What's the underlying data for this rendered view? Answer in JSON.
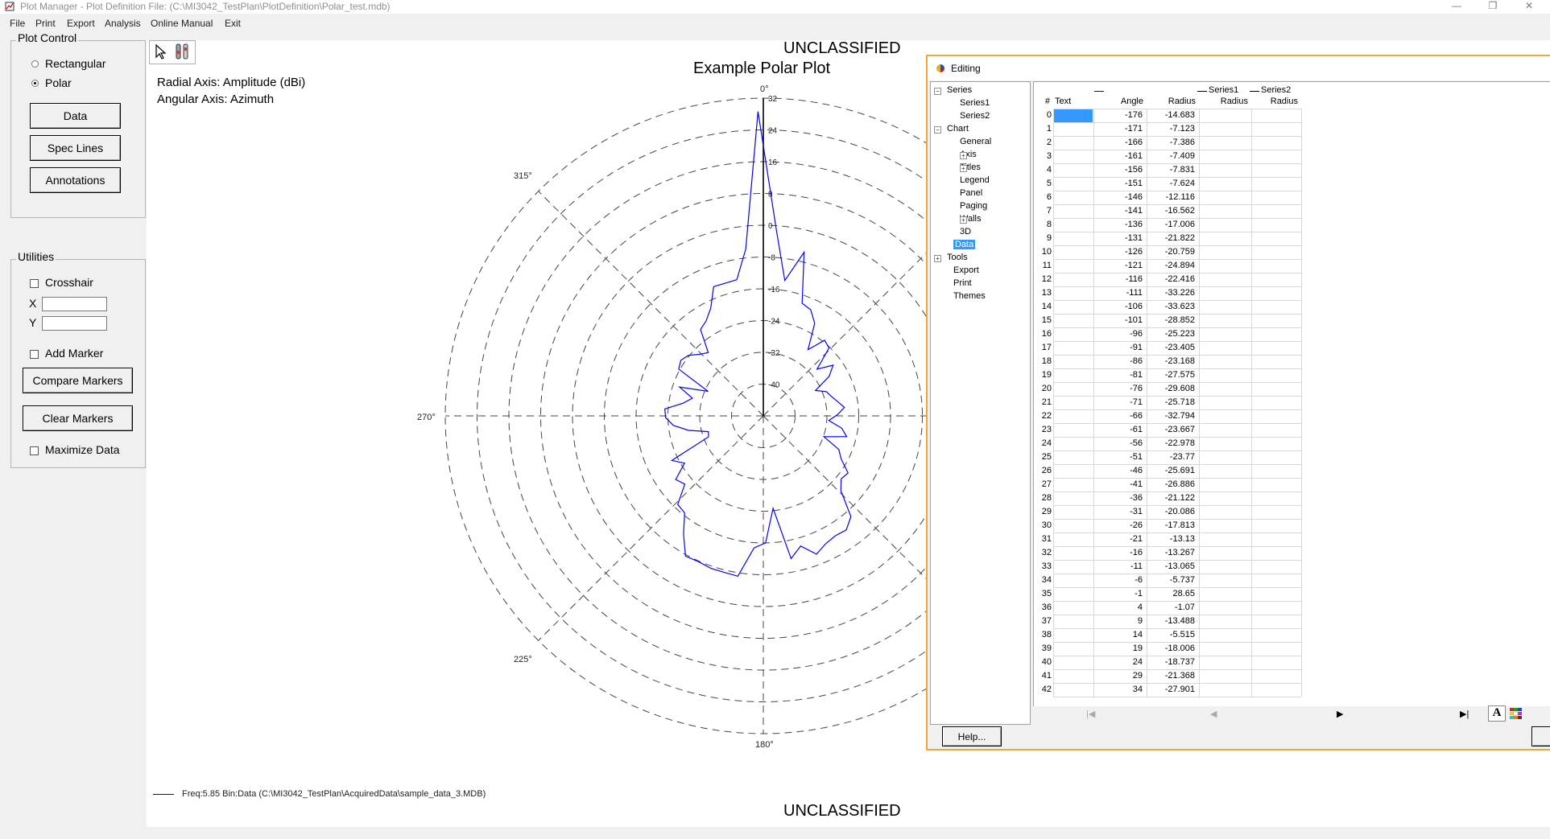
{
  "window": {
    "title": "Plot Manager - Plot Definition File: (C:\\MI3042_TestPlan\\PlotDefinition\\Polar_test.mdb)",
    "minimize_glyph": "—",
    "restore_glyph": "❐",
    "close_glyph": "✕"
  },
  "menu": [
    "File",
    "Print",
    "Export",
    "Analysis",
    "Online Manual",
    "Exit"
  ],
  "plot_control": {
    "title": "Plot Control",
    "options": [
      {
        "label": "Rectangular",
        "selected": false
      },
      {
        "label": "Polar",
        "selected": true
      }
    ],
    "buttons": {
      "data": "Data",
      "spec_lines": "Spec Lines",
      "annotations": "Annotations"
    }
  },
  "utilities": {
    "title": "Utilities",
    "crosshair_label": "Crosshair",
    "crosshair_checked": false,
    "x_label": "X",
    "y_label": "Y",
    "x_value": "",
    "y_value": "",
    "add_marker_label": "Add Marker",
    "add_marker_checked": false,
    "compare_markers": "Compare Markers",
    "clear_markers": "Clear Markers",
    "maximize_data_label": "Maximize Data",
    "maximize_data_checked": false
  },
  "plot": {
    "classification_top": "UNCLASSIFIED",
    "classification_bottom": "UNCLASSIFIED",
    "radial_axis_info": "Radial Axis: Amplitude (dBi)",
    "angular_axis_info": "Angular Axis: Azimuth",
    "legend_text": "Freq:5.85  Bin:Data  (C:\\MI3042_TestPlan\\AcquiredData\\sample_data_3.MDB)",
    "toolbar_icons": [
      "pointer-icon",
      "tools-icon"
    ],
    "series_color": "#0000ff"
  },
  "chart_data": {
    "type": "line",
    "projection": "polar",
    "title": "Example Polar Plot",
    "angle_labels": [
      "0°",
      "315°",
      "270°",
      "225°",
      "180°"
    ],
    "radial_ticks": [
      32,
      24,
      16,
      8,
      0,
      -8,
      -16,
      -24,
      -32,
      -40
    ],
    "radial_range": [
      -48,
      32
    ],
    "grid": true,
    "series": [
      {
        "name": "",
        "points": [
          [
            -176,
            -14.683
          ],
          [
            -171,
            -7.123
          ],
          [
            -166,
            -7.386
          ],
          [
            -161,
            -7.409
          ],
          [
            -156,
            -7.831
          ],
          [
            -151,
            -7.624
          ],
          [
            -146,
            -12.116
          ],
          [
            -141,
            -16.562
          ],
          [
            -136,
            -17.006
          ],
          [
            -131,
            -21.822
          ],
          [
            -126,
            -20.759
          ],
          [
            -121,
            -24.894
          ],
          [
            -116,
            -22.416
          ],
          [
            -111,
            -33.226
          ],
          [
            -106,
            -33.623
          ],
          [
            -101,
            -28.852
          ],
          [
            -96,
            -25.223
          ],
          [
            -91,
            -23.405
          ],
          [
            -86,
            -23.168
          ],
          [
            -81,
            -27.575
          ],
          [
            -76,
            -29.608
          ],
          [
            -71,
            -25.718
          ],
          [
            -66,
            -32.794
          ],
          [
            -61,
            -23.667
          ],
          [
            -56,
            -22.978
          ],
          [
            -51,
            -23.77
          ],
          [
            -46,
            -25.691
          ],
          [
            -41,
            -26.886
          ],
          [
            -36,
            -21.122
          ],
          [
            -31,
            -20.086
          ],
          [
            -26,
            -17.813
          ],
          [
            -21,
            -13.13
          ],
          [
            -16,
            -13.267
          ],
          [
            -11,
            -13.065
          ],
          [
            -6,
            -5.737
          ],
          [
            -1,
            28.65
          ],
          [
            4,
            -1.07
          ],
          [
            9,
            -13.488
          ],
          [
            14,
            -5.515
          ],
          [
            19,
            -18.006
          ],
          [
            24,
            -18.737
          ],
          [
            29,
            -21.368
          ],
          [
            34,
            -27.901
          ],
          [
            39,
            -23.5
          ],
          [
            44,
            -24.2
          ],
          [
            49,
            -30.1
          ],
          [
            54,
            -26.3
          ],
          [
            59,
            -28.7
          ],
          [
            64,
            -33.4
          ],
          [
            69,
            -31.0
          ],
          [
            74,
            -30.2
          ],
          [
            79,
            -29.0
          ],
          [
            84,
            -27.5
          ],
          [
            89,
            -29.3
          ],
          [
            94,
            -31.5
          ],
          [
            99,
            -28.0
          ],
          [
            104,
            -26.4
          ],
          [
            109,
            -31.9
          ],
          [
            114,
            -27.2
          ],
          [
            119,
            -25.6
          ],
          [
            124,
            -22.3
          ],
          [
            129,
            -22.8
          ],
          [
            134,
            -20.9
          ],
          [
            139,
            -14.4
          ],
          [
            144,
            -12.5
          ],
          [
            149,
            -12.8
          ],
          [
            154,
            -12.2
          ],
          [
            159,
            -10.7
          ],
          [
            164,
            -13.9
          ],
          [
            169,
            -11.4
          ],
          [
            174,
            -24.6
          ],
          [
            179,
            -16.0
          ]
        ]
      }
    ]
  },
  "editing": {
    "title": "Editing",
    "tree": [
      {
        "label": "Series",
        "indent": 0,
        "expander": "−"
      },
      {
        "label": "Series1",
        "indent": 2,
        "expander": ""
      },
      {
        "label": "Series2",
        "indent": 2,
        "expander": ""
      },
      {
        "label": "Chart",
        "indent": 0,
        "expander": "−"
      },
      {
        "label": "General",
        "indent": 2,
        "expander": ""
      },
      {
        "label": "Axis",
        "indent": 2,
        "expander": "+"
      },
      {
        "label": "Titles",
        "indent": 2,
        "expander": "+"
      },
      {
        "label": "Legend",
        "indent": 2,
        "expander": ""
      },
      {
        "label": "Panel",
        "indent": 2,
        "expander": ""
      },
      {
        "label": "Paging",
        "indent": 2,
        "expander": ""
      },
      {
        "label": "Walls",
        "indent": 2,
        "expander": "+"
      },
      {
        "label": "3D",
        "indent": 2,
        "expander": ""
      },
      {
        "label": "Data",
        "indent": 1,
        "expander": "",
        "selected": true
      },
      {
        "label": "Tools",
        "indent": 0,
        "expander": "+"
      },
      {
        "label": "Export",
        "indent": 1,
        "expander": ""
      },
      {
        "label": "Print",
        "indent": 1,
        "expander": ""
      },
      {
        "label": "Themes",
        "indent": 1,
        "expander": ""
      }
    ],
    "grid": {
      "series_headers": [
        "Series1",
        "Series2"
      ],
      "columns": [
        "#",
        "Text",
        "Angle",
        "Radius",
        "Radius",
        "Radius"
      ],
      "rows": [
        [
          "0",
          "",
          "-176",
          "-14.683"
        ],
        [
          "1",
          "",
          "-171",
          "-7.123"
        ],
        [
          "2",
          "",
          "-166",
          "-7.386"
        ],
        [
          "3",
          "",
          "-161",
          "-7.409"
        ],
        [
          "4",
          "",
          "-156",
          "-7.831"
        ],
        [
          "5",
          "",
          "-151",
          "-7.624"
        ],
        [
          "6",
          "",
          "-146",
          "-12.116"
        ],
        [
          "7",
          "",
          "-141",
          "-16.562"
        ],
        [
          "8",
          "",
          "-136",
          "-17.006"
        ],
        [
          "9",
          "",
          "-131",
          "-21.822"
        ],
        [
          "10",
          "",
          "-126",
          "-20.759"
        ],
        [
          "11",
          "",
          "-121",
          "-24.894"
        ],
        [
          "12",
          "",
          "-116",
          "-22.416"
        ],
        [
          "13",
          "",
          "-111",
          "-33.226"
        ],
        [
          "14",
          "",
          "-106",
          "-33.623"
        ],
        [
          "15",
          "",
          "-101",
          "-28.852"
        ],
        [
          "16",
          "",
          "-96",
          "-25.223"
        ],
        [
          "17",
          "",
          "-91",
          "-23.405"
        ],
        [
          "18",
          "",
          "-86",
          "-23.168"
        ],
        [
          "19",
          "",
          "-81",
          "-27.575"
        ],
        [
          "20",
          "",
          "-76",
          "-29.608"
        ],
        [
          "21",
          "",
          "-71",
          "-25.718"
        ],
        [
          "22",
          "",
          "-66",
          "-32.794"
        ],
        [
          "23",
          "",
          "-61",
          "-23.667"
        ],
        [
          "24",
          "",
          "-56",
          "-22.978"
        ],
        [
          "25",
          "",
          "-51",
          "-23.77"
        ],
        [
          "26",
          "",
          "-46",
          "-25.691"
        ],
        [
          "27",
          "",
          "-41",
          "-26.886"
        ],
        [
          "28",
          "",
          "-36",
          "-21.122"
        ],
        [
          "29",
          "",
          "-31",
          "-20.086"
        ],
        [
          "30",
          "",
          "-26",
          "-17.813"
        ],
        [
          "31",
          "",
          "-21",
          "-13.13"
        ],
        [
          "32",
          "",
          "-16",
          "-13.267"
        ],
        [
          "33",
          "",
          "-11",
          "-13.065"
        ],
        [
          "34",
          "",
          "-6",
          "-5.737"
        ],
        [
          "35",
          "",
          "-1",
          "28.65"
        ],
        [
          "36",
          "",
          "4",
          "-1.07"
        ],
        [
          "37",
          "",
          "9",
          "-13.488"
        ],
        [
          "38",
          "",
          "14",
          "-5.515"
        ],
        [
          "39",
          "",
          "19",
          "-18.006"
        ],
        [
          "40",
          "",
          "24",
          "-18.737"
        ],
        [
          "41",
          "",
          "29",
          "-21.368"
        ],
        [
          "42",
          "",
          "34",
          "-27.901"
        ]
      ]
    },
    "nav": {
      "first": "|◀",
      "prev": "◀",
      "next": "▶",
      "last": "▶|"
    },
    "help_button": "Help...",
    "font_glyph": "A",
    "help_underline_char": "H"
  }
}
